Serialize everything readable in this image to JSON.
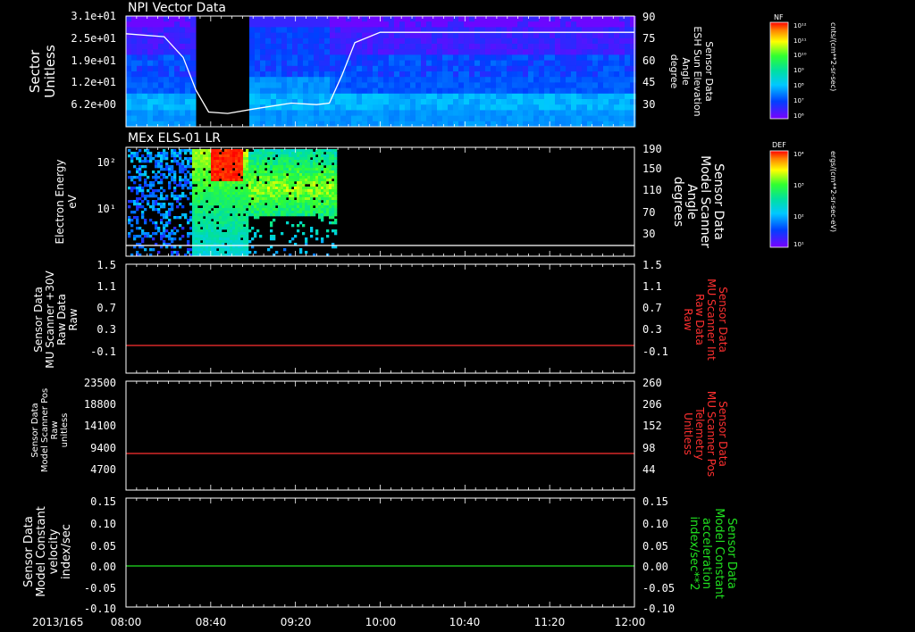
{
  "date_label": "2013/165",
  "colors": {
    "background": "#000000",
    "foreground": "#ffffff",
    "red_trace": "#ff3030",
    "green_trace": "#20e020"
  },
  "time_axis": {
    "ticks": [
      "08:00",
      "08:40",
      "09:20",
      "10:00",
      "10:40",
      "11:20",
      "12:00"
    ],
    "range": [
      "08:00",
      "12:00"
    ]
  },
  "panels": [
    {
      "id": "npi",
      "title": "NPI Vector Data",
      "left_label": [
        "Sector",
        "Unitless"
      ],
      "left_ticks": [
        "3.1e+01",
        "2.5e+01",
        "1.9e+01",
        "1.2e+01",
        "6.2e+00"
      ],
      "right_label": [
        "Sensor Data",
        "ESH Sun Elevation",
        "Angle",
        "degree"
      ],
      "right_ticks": [
        "90",
        "75",
        "60",
        "45",
        "30"
      ],
      "colorbar": {
        "label": "NF",
        "unit": "cnts/(cm**2-sr-sec)",
        "ticks": [
          "10¹²",
          "10¹¹",
          "10¹⁰",
          "10⁹",
          "10⁸",
          "10⁷",
          "10⁶"
        ]
      }
    },
    {
      "id": "els",
      "title": "MEx ELS-01 LR",
      "left_label": [
        "Electron Energy",
        "eV"
      ],
      "left_ticks": [
        "10²",
        "10¹"
      ],
      "right_label": [
        "Sensor Data",
        "Model Scanner",
        "Angle",
        "degrees"
      ],
      "right_ticks": [
        "190",
        "150",
        "110",
        "70",
        "30"
      ],
      "colorbar": {
        "label": "DEF",
        "unit": "ergs/(cm**2-sr-sec-eV)",
        "ticks": [
          "10⁴",
          "10³",
          "10²",
          "10¹"
        ]
      }
    },
    {
      "id": "mu_int",
      "left_label": [
        "Sensor Data",
        "MU Scanner +30V",
        "Raw Data",
        "Raw"
      ],
      "left_ticks": [
        "1.5",
        "1.1",
        "0.7",
        "0.3",
        "-0.1"
      ],
      "right_label": [
        "Sensor Data",
        "MU Scanner Int",
        "Raw Data",
        "Raw"
      ],
      "right_ticks": [
        "1.5",
        "1.1",
        "0.7",
        "0.3",
        "-0.1"
      ]
    },
    {
      "id": "mu_pos",
      "left_label": [
        "Sensor Data",
        "Model Scanner Pos",
        "Raw",
        "unitless"
      ],
      "left_ticks": [
        "23500",
        "18800",
        "14100",
        "9400",
        "4700"
      ],
      "right_label": [
        "Sensor Data",
        "MU Scanner Pos",
        "Telemetry",
        "Unitless"
      ],
      "right_ticks": [
        "260",
        "206",
        "152",
        "98",
        "44"
      ]
    },
    {
      "id": "model",
      "left_label": [
        "Sensor Data",
        "Model Constant",
        "velocity",
        "index/sec"
      ],
      "left_ticks": [
        "0.15",
        "0.10",
        "0.05",
        "0.00",
        "-0.05",
        "-0.10"
      ],
      "right_label": [
        "Sensor Data",
        "Model Constant",
        "acceleration",
        "index/sec**2"
      ],
      "right_ticks": [
        "0.15",
        "0.10",
        "0.05",
        "0.00",
        "-0.05",
        "-0.10"
      ]
    }
  ],
  "chart_data": [
    {
      "type": "heatmap",
      "title": "NPI Vector Data",
      "ylabel": "Sector Unitless",
      "y2label": "Sensor Data ESH Sun Elevation Angle degree",
      "ylim": [
        0,
        32
      ],
      "y2lim": [
        15,
        90
      ],
      "series": [
        {
          "name": "ESH Sun Elevation",
          "x_hours": [
            8.0,
            8.3,
            8.45,
            8.55,
            8.65,
            8.8,
            9.0,
            9.3,
            9.5,
            9.6,
            9.7,
            9.8,
            10.0,
            11.0,
            12.0
          ],
          "y": [
            78,
            76,
            62,
            40,
            25,
            24,
            27,
            31,
            30,
            31,
            50,
            72,
            79,
            79,
            79
          ]
        }
      ]
    },
    {
      "type": "heatmap",
      "title": "MEx ELS-01 LR",
      "ylabel": "Electron Energy eV",
      "y2label": "Sensor Data Model Scanner Angle degrees",
      "y2lim": [
        10,
        190
      ],
      "series": [
        {
          "name": "Model Scanner Angle",
          "x_hours": [
            8.0,
            12.0
          ],
          "y": [
            12,
            12
          ]
        }
      ]
    },
    {
      "type": "line",
      "ylabel": "Sensor Data MU Scanner +30V Raw Data Raw",
      "y2label": "Sensor Data MU Scanner Int Raw Data Raw",
      "ylim": [
        -0.3,
        1.5
      ],
      "series": [
        {
          "name": "MU Scanner Int Raw Data",
          "x_hours": [
            8.0,
            12.0
          ],
          "y": [
            0.0,
            0.0
          ]
        }
      ]
    },
    {
      "type": "line",
      "ylabel": "Sensor Data Model Scanner Pos Raw unitless",
      "y2label": "Sensor Data MU Scanner Pos Telemetry Unitless",
      "ylim": [
        0,
        23500
      ],
      "y2lim": [
        0,
        260
      ],
      "series": [
        {
          "name": "MU Scanner Pos Telemetry",
          "x_hours": [
            8.0,
            12.0
          ],
          "y": [
            8500,
            8500
          ]
        }
      ]
    },
    {
      "type": "line",
      "ylabel": "Sensor Data Model Constant velocity index/sec",
      "y2label": "Sensor Data Model Constant acceleration index/sec**2",
      "ylim": [
        -0.1,
        0.15
      ],
      "series": [
        {
          "name": "Model Constant acceleration",
          "x_hours": [
            8.0,
            12.0
          ],
          "y": [
            0.0,
            0.0
          ]
        }
      ]
    }
  ]
}
